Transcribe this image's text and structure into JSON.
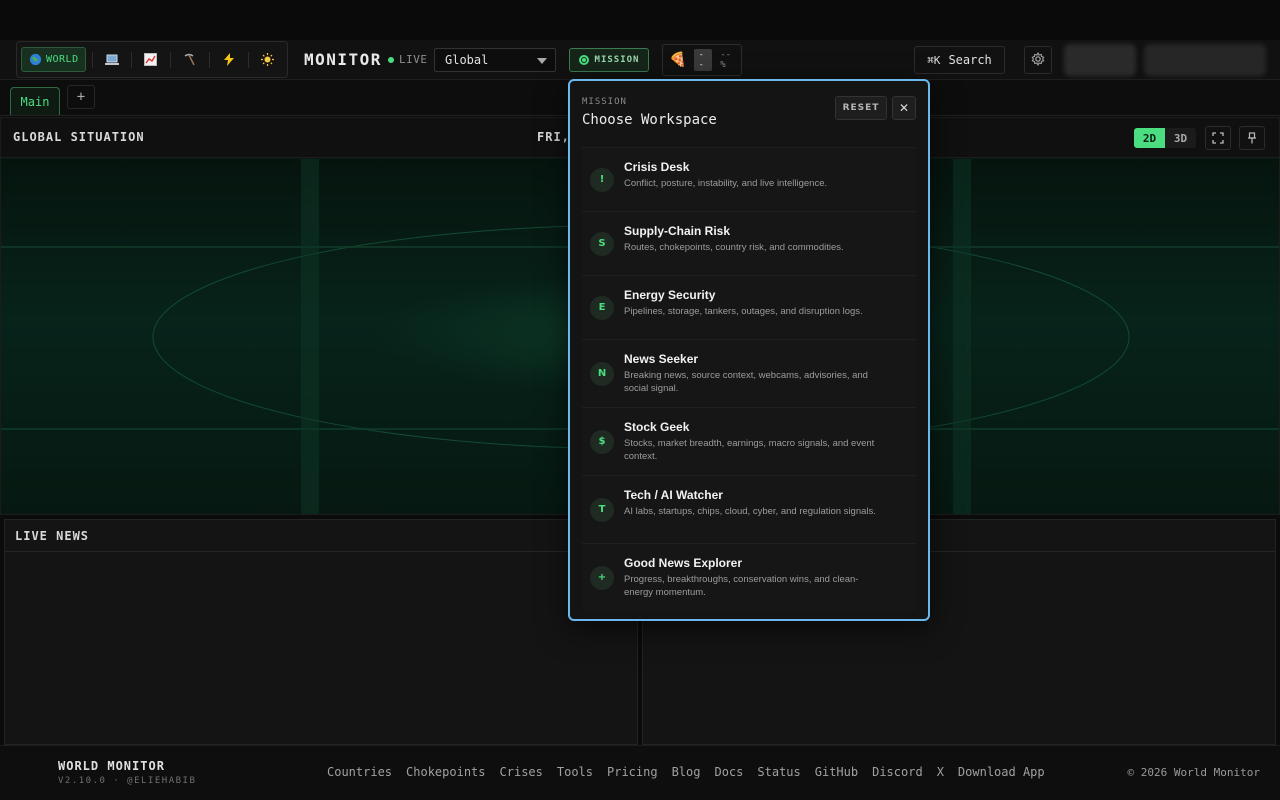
{
  "header": {
    "variants": [
      {
        "label": "WORLD",
        "icon": "globe-icon",
        "active": true
      },
      {
        "label": "",
        "icon": "laptop-icon"
      },
      {
        "label": "",
        "icon": "chart-icon"
      },
      {
        "label": "",
        "icon": "pickaxe-icon"
      },
      {
        "label": "",
        "icon": "lightning-icon"
      },
      {
        "label": "",
        "icon": "sun-icon"
      }
    ],
    "brand": "MONITOR",
    "live_label": "LIVE",
    "region_value": "Global",
    "mission_label": "MISSION",
    "pizza_badge": "--",
    "pizza_value": "--%",
    "search_kbd": "⌘K",
    "search_label": "Search",
    "accent_color": "#4ade80"
  },
  "tabs": {
    "main_label": "Main",
    "add_label": "+"
  },
  "map": {
    "title": "GLOBAL SITUATION",
    "date": "FRI,",
    "dim_2d": "2D",
    "dim_3d": "3D",
    "active_dim": "2D"
  },
  "news": {
    "title": "LIVE NEWS"
  },
  "mission_popup": {
    "kicker": "MISSION",
    "title": "Choose Workspace",
    "reset_label": "RESET",
    "close_label": "✕",
    "items": [
      {
        "badge": "!",
        "name": "Crisis Desk",
        "desc": "Conflict, posture, instability, and live intelligence."
      },
      {
        "badge": "S",
        "name": "Supply-Chain Risk",
        "desc": "Routes, chokepoints, country risk, and commodities."
      },
      {
        "badge": "E",
        "name": "Energy Security",
        "desc": "Pipelines, storage, tankers, outages, and disruption logs."
      },
      {
        "badge": "N",
        "name": "News Seeker",
        "desc": "Breaking news, source context, webcams, advisories, and social signal."
      },
      {
        "badge": "$",
        "name": "Stock Geek",
        "desc": "Stocks, market breadth, earnings, macro signals, and event context."
      },
      {
        "badge": "T",
        "name": "Tech / AI Watcher",
        "desc": "AI labs, startups, chips, cloud, cyber, and regulation signals."
      },
      {
        "badge": "+",
        "name": "Good News Explorer",
        "desc": "Progress, breakthroughs, conservation wins, and clean-energy momentum."
      }
    ]
  },
  "footer": {
    "brand": "WORLD MONITOR",
    "version": "V2.10.0 · @ELIEHABIB",
    "links": [
      "Countries",
      "Chokepoints",
      "Crises",
      "Tools",
      "Pricing",
      "Blog",
      "Docs",
      "Status",
      "GitHub",
      "Discord",
      "X",
      "Download App"
    ],
    "copyright": "© 2026 World Monitor"
  }
}
